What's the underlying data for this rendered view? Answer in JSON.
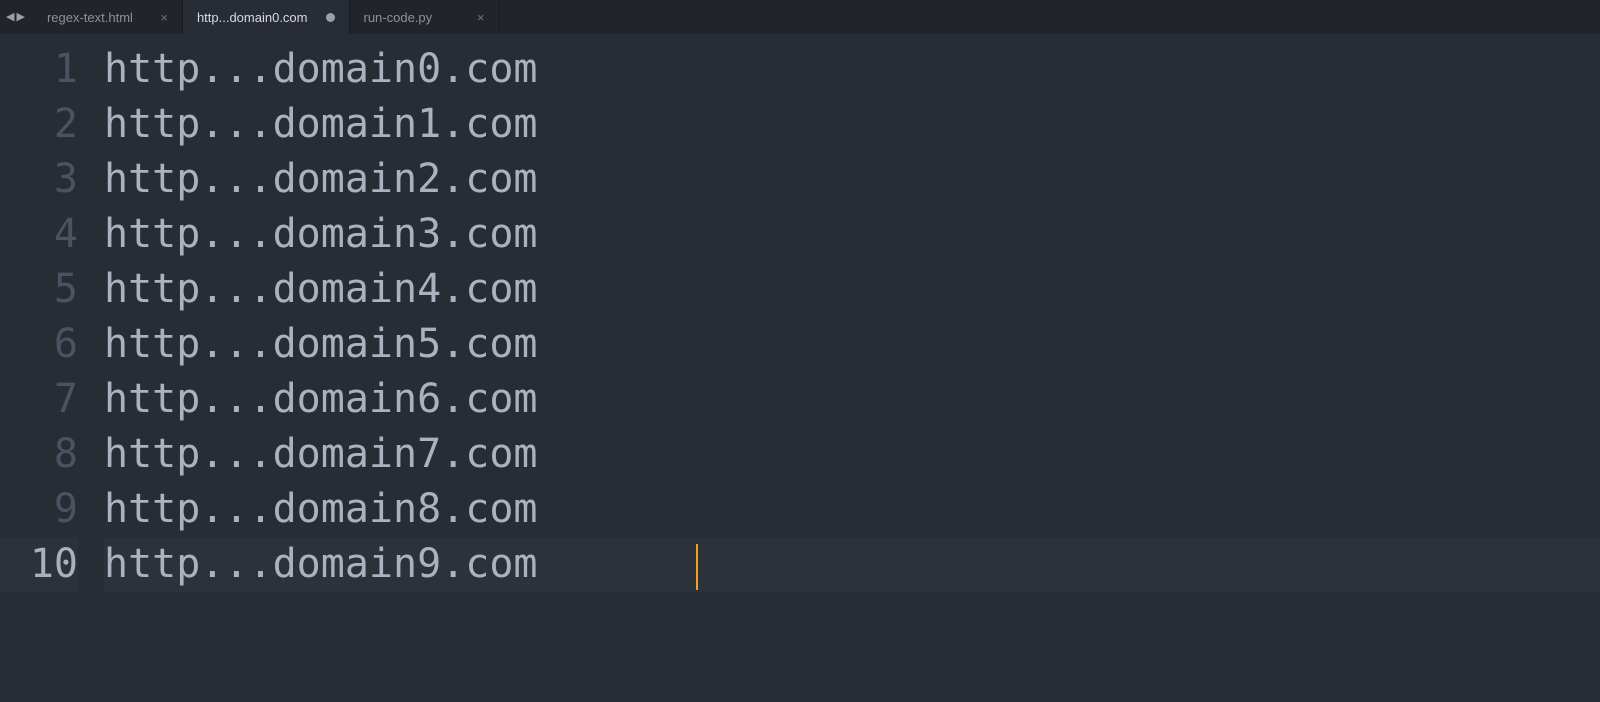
{
  "tabs": [
    {
      "label": "regex-text.html",
      "active": false,
      "modified": false
    },
    {
      "label": "http...domain0.com",
      "active": true,
      "modified": true
    },
    {
      "label": "run-code.py",
      "active": false,
      "modified": false
    }
  ],
  "lines": [
    {
      "n": "1",
      "text": "http...domain0.com"
    },
    {
      "n": "2",
      "text": "http...domain1.com"
    },
    {
      "n": "3",
      "text": "http...domain2.com"
    },
    {
      "n": "4",
      "text": "http...domain3.com"
    },
    {
      "n": "5",
      "text": "http...domain4.com"
    },
    {
      "n": "6",
      "text": "http...domain5.com"
    },
    {
      "n": "7",
      "text": "http...domain6.com"
    },
    {
      "n": "8",
      "text": "http...domain7.com"
    },
    {
      "n": "9",
      "text": "http...domain8.com"
    },
    {
      "n": "10",
      "text": "http...domain9.com"
    }
  ],
  "current_line_index": 9,
  "icons": {
    "nav_prev": "◀",
    "nav_next": "▶",
    "close": "×"
  }
}
